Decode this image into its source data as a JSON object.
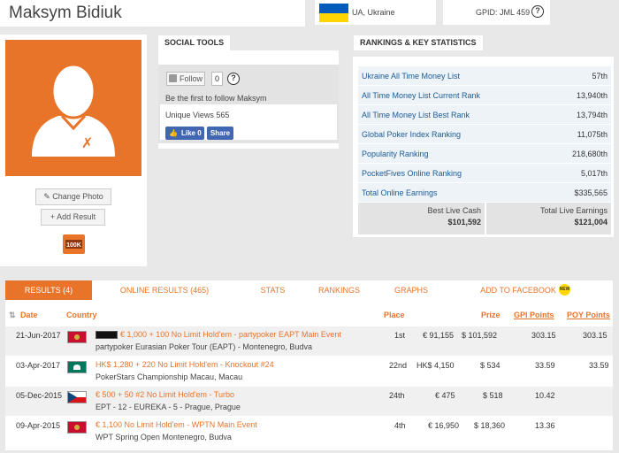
{
  "profile": {
    "name": "Maksym Bidiuk",
    "country": "UA, Ukraine",
    "gpid": "GPID: JML 459",
    "change_photo": "Change Photo",
    "add_result": "Add Result",
    "badge": "100K"
  },
  "social": {
    "title": "SOCIAL TOOLS",
    "follow_label": "Follow",
    "follow_count": "0",
    "follow_text": "Be the first to follow Maksym",
    "views": "Unique Views 565",
    "like_label": "Like 0",
    "share_label": "Share"
  },
  "rankings": {
    "title": "RANKINGS & KEY STATISTICS",
    "rows": [
      {
        "label": "Ukraine All Time Money List",
        "value": "57th"
      },
      {
        "label": "All Time Money List Current Rank",
        "value": "13,940th"
      },
      {
        "label": "All Time Money List Best Rank",
        "value": "13,794th"
      },
      {
        "label": "Global Poker Index Ranking",
        "value": "11,075th"
      },
      {
        "label": "Popularity Ranking",
        "value": "218,680th"
      },
      {
        "label": "PocketFives Online Ranking",
        "value": "5,017th"
      },
      {
        "label": "Total Online Earnings",
        "value": "$335,565"
      }
    ],
    "best_live_label": "Best Live Cash",
    "best_live_value": "$101,592",
    "total_live_label": "Total Live Earnings",
    "total_live_value": "$121,004"
  },
  "tabs": [
    {
      "label": "RESULTS (4)"
    },
    {
      "label": "ONLINE RESULTS (465)"
    },
    {
      "label": "STATS"
    },
    {
      "label": "RANKINGS"
    },
    {
      "label": "GRAPHS"
    },
    {
      "label": "ADD TO FACEBOOK"
    }
  ],
  "new_badge": "NEW",
  "results": {
    "headers": {
      "date": "Date",
      "country": "Country",
      "place": "Place",
      "prize": "Prize",
      "gpi": "GPI Points",
      "poy": "POY Points"
    },
    "rows": [
      {
        "date": "21-Jun-2017",
        "event": "€ 1,000 + 100 No Limit Hold'em - partypoker EAPT Main Event",
        "series": "partypoker Eurasian Poker Tour (EAPT) - Montenegro, Budva",
        "place": "1st",
        "local": "€ 91,155",
        "prize": "$ 101,592",
        "gpi": "303.15",
        "poy": "303.15"
      },
      {
        "date": "03-Apr-2017",
        "event": "HK$ 1,280 + 220 No Limit Hold'em - Knockout #24",
        "series": "PokerStars Championship Macau, Macau",
        "place": "22nd",
        "local": "HK$ 4,150",
        "prize": "$ 534",
        "gpi": "33.59",
        "poy": "33.59"
      },
      {
        "date": "05-Dec-2015",
        "event": "€ 500 + 50 #2 No Limit Hold'em - Turbo",
        "series": "EPT - 12 - EUREKA - 5 - Prague, Prague",
        "place": "24th",
        "local": "€ 475",
        "prize": "$ 518",
        "gpi": "10.42",
        "poy": ""
      },
      {
        "date": "09-Apr-2015",
        "event": "€ 1,100 No Limit Hold'em - WPTN Main Event",
        "series": "WPT Spring Open Montenegro, Budva",
        "place": "4th",
        "local": "€ 16,950",
        "prize": "$ 18,360",
        "gpi": "13.36",
        "poy": ""
      }
    ]
  },
  "colors": {
    "accent": "#e8742a",
    "link": "#1a5a96",
    "facebook": "#4267b2"
  }
}
